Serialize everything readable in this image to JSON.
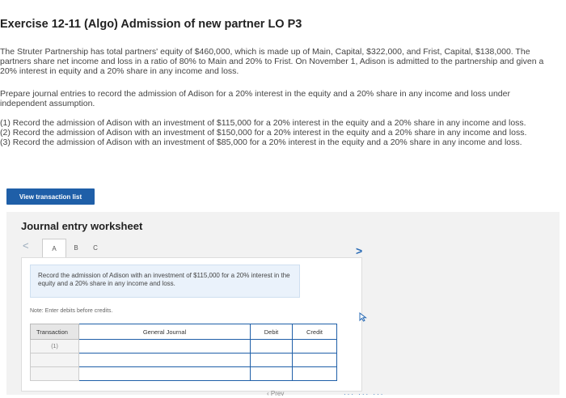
{
  "header": {
    "title": "Exercise 12-11 (Algo) Admission of new partner LO P3"
  },
  "problem": {
    "paragraph1": "The Struter Partnership has total partners' equity of $460,000, which is made up of Main, Capital, $322,000, and Frist, Capital, $138,000. The partners share net income and loss in a ratio of 80% to Main and 20% to Frist. On November 1, Adison is admitted to the partnership and given a 20% interest in equity and a 20% share in any income and loss.",
    "paragraph2": "Prepare journal entries to record the admission of Adison for a 20% interest in the equity and a 20% share in any income and loss under independent assumption.",
    "requirements": [
      "(1) Record the admission of Adison with an investment of $115,000 for a 20% interest in the equity and a 20% share in any income and loss.",
      "(2) Record the admission of Adison with an investment of $150,000 for a 20% interest in the equity and a 20% share in any income and loss.",
      "(3) Record the admission of Adison with an investment of $85,000 for a 20% interest in the equity and a 20% share in any income and loss."
    ]
  },
  "buttons": {
    "view_transaction_list": "View transaction list",
    "prev": "Prev"
  },
  "worksheet": {
    "title": "Journal entry worksheet",
    "nav_left": "<",
    "nav_right": ">",
    "tabs": [
      "A",
      "B",
      "C"
    ],
    "active_tab": "A",
    "instruction": "Record the admission of Adison with an investment of $115,000 for a 20% interest in the equity and a 20% share in any income and loss.",
    "note": "Note: Enter debits before credits.",
    "table": {
      "headers": {
        "transaction": "Transaction",
        "general_journal": "General Journal",
        "debit": "Debit",
        "credit": "Credit"
      },
      "rows": [
        {
          "transaction": "(1)",
          "general_journal": "",
          "debit": "",
          "credit": ""
        },
        {
          "transaction": "",
          "general_journal": "",
          "debit": "",
          "credit": ""
        },
        {
          "transaction": "",
          "general_journal": "",
          "debit": "",
          "credit": ""
        }
      ]
    }
  },
  "pagination": {
    "dots": "··· ··· ···"
  },
  "colors": {
    "accent": "#1f5fa8",
    "panel_background": "#f2f2f2",
    "instruction_background": "#eaf2fb"
  }
}
